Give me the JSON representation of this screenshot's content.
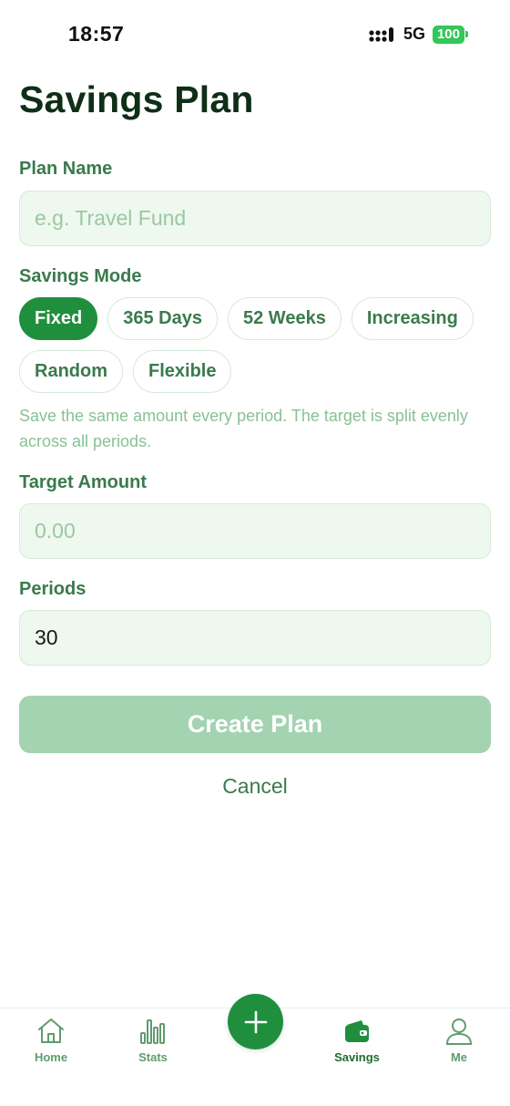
{
  "status_bar": {
    "time": "18:57",
    "network": "5G",
    "battery": "100",
    "battery_color": "#34c759"
  },
  "page": {
    "title": "Savings Plan"
  },
  "form": {
    "plan_name": {
      "label": "Plan Name",
      "placeholder": "e.g. Travel Fund",
      "value": ""
    },
    "savings_mode": {
      "label": "Savings Mode",
      "options": [
        "Fixed",
        "365 Days",
        "52 Weeks",
        "Increasing",
        "Random",
        "Flexible"
      ],
      "selected": "Fixed",
      "description": "Save the same amount every period. The target is split evenly across all periods."
    },
    "target_amount": {
      "label": "Target Amount",
      "placeholder": "0.00",
      "value": ""
    },
    "periods": {
      "label": "Periods",
      "value": "30"
    },
    "create_button": "Create Plan",
    "cancel_button": "Cancel"
  },
  "tab_bar": {
    "items": [
      {
        "label": "Home",
        "icon": "home-icon",
        "active": false
      },
      {
        "label": "Stats",
        "icon": "bar-chart-icon",
        "active": false
      },
      {
        "label": "Savings",
        "icon": "wallet-icon",
        "active": true
      },
      {
        "label": "Me",
        "icon": "person-icon",
        "active": false
      }
    ],
    "fab_icon": "plus-icon"
  },
  "colors": {
    "primary": "#1f8f3e",
    "primary_disabled": "#a3d3b0",
    "label_green": "#3a7a4c",
    "input_bg": "#eef8ee"
  }
}
